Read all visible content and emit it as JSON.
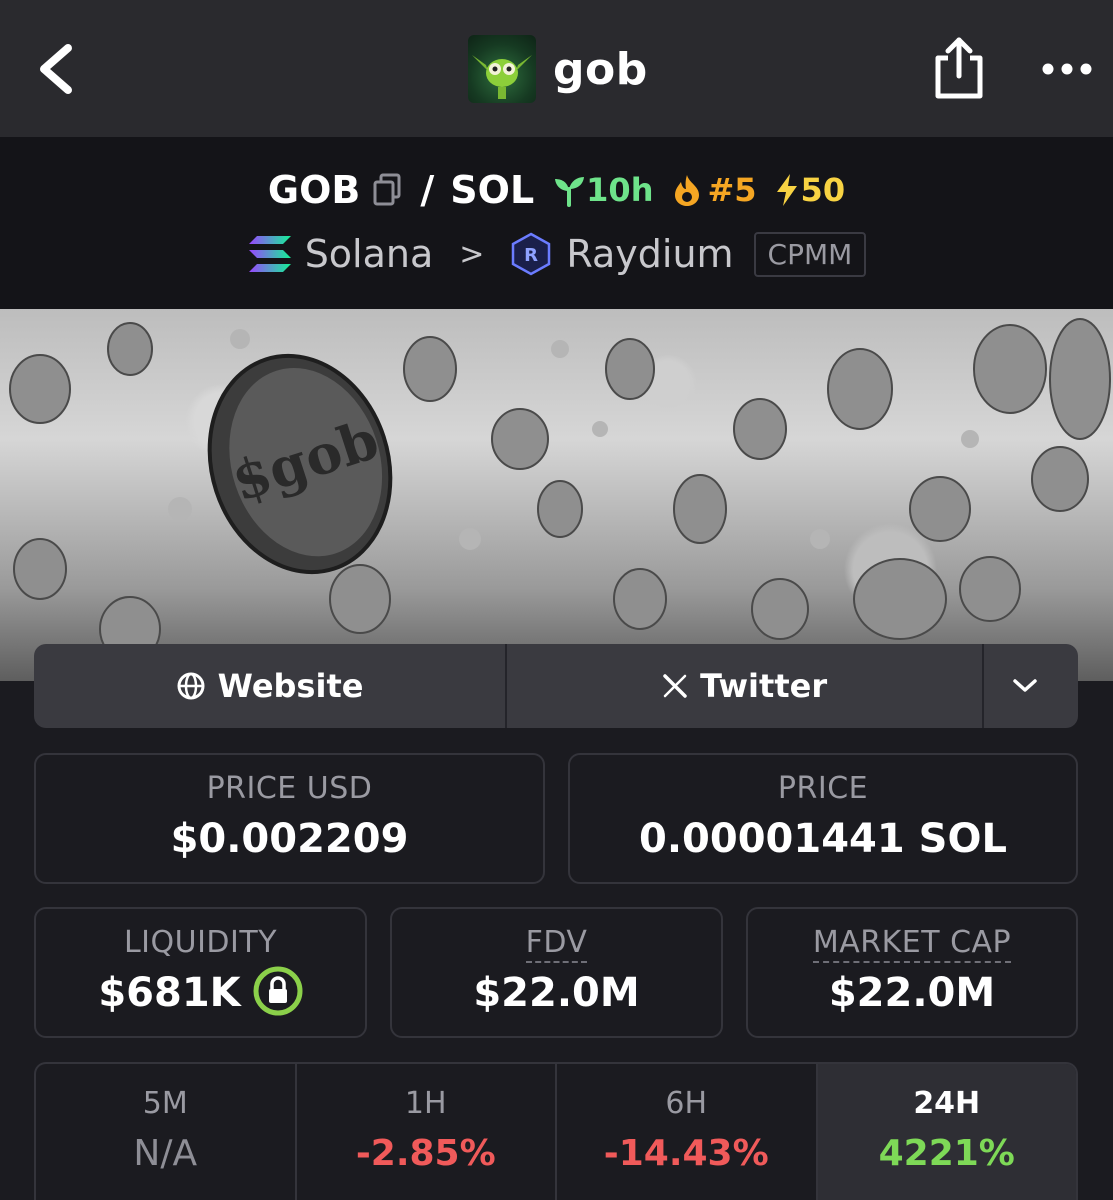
{
  "nav": {
    "title": "gob",
    "back_icon": "chevron-left-icon",
    "share_icon": "share-icon",
    "more_icon": "more-dots-icon"
  },
  "pair": {
    "base": "GOB",
    "quote": "SOL",
    "age": "10h",
    "rank": "#5",
    "boosts": "50",
    "chain": "Solana",
    "dex": "Raydium",
    "pool_type": "CPMM"
  },
  "links": {
    "website": "Website",
    "twitter": "Twitter"
  },
  "stats": {
    "price_usd_label": "PRICE USD",
    "price_usd": "$0.002209",
    "price_label": "PRICE",
    "price": "0.00001441 SOL",
    "liquidity_label": "LIQUIDITY",
    "liquidity": "$681K",
    "fdv_label": "FDV",
    "fdv": "$22.0M",
    "mcap_label": "MARKET CAP",
    "mcap": "$22.0M"
  },
  "changes": [
    {
      "label": "5M",
      "value": "N/A"
    },
    {
      "label": "1H",
      "value": "-2.85%"
    },
    {
      "label": "6H",
      "value": "-14.43%"
    },
    {
      "label": "24H",
      "value": "4221%"
    }
  ],
  "colors": {
    "negative": "#f05a5a",
    "positive": "#7ed957",
    "neutral": "#8e8e96",
    "age": "#6ee38a",
    "rank": "#f5a623",
    "boost": "#f8d343"
  }
}
